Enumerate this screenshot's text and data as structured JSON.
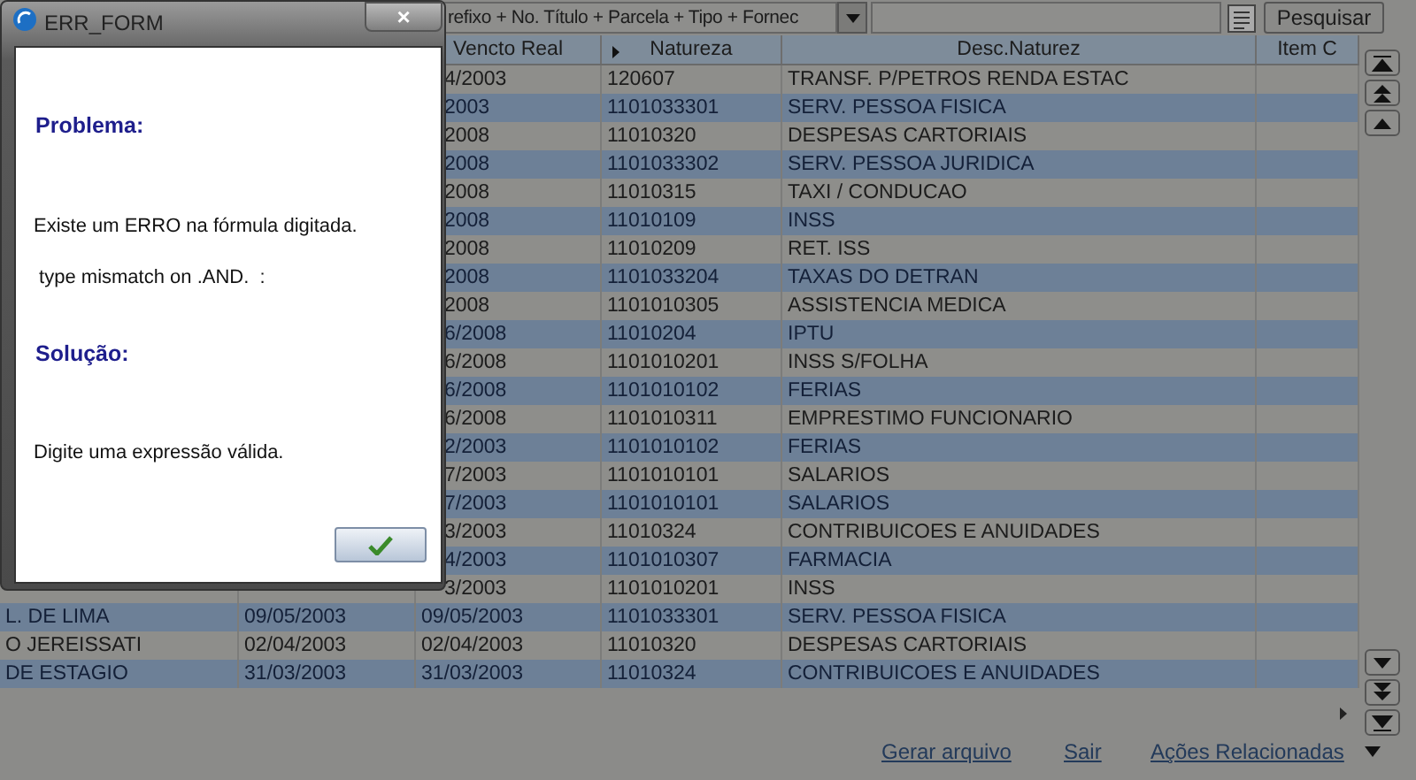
{
  "toolbar": {
    "sort_combo": "refixo + No. Título + Parcela + Tipo + Fornec",
    "search_button": "Pesquisar"
  },
  "table": {
    "columns": [
      "Vencto Real",
      "Natureza",
      "Desc.Naturez",
      "Item C"
    ],
    "rows": [
      {
        "vencto_real": "4/2003",
        "natureza": "120607",
        "desc_naturez": "TRANSF. P/PETROS RENDA ESTAC"
      },
      {
        "vencto_real": "2003",
        "natureza": "1101033301",
        "desc_naturez": "SERV. PESSOA FISICA"
      },
      {
        "vencto_real": "2008",
        "natureza": "11010320",
        "desc_naturez": "DESPESAS CARTORIAIS"
      },
      {
        "vencto_real": "2008",
        "natureza": "1101033302",
        "desc_naturez": "SERV. PESSOA JURIDICA"
      },
      {
        "vencto_real": "2008",
        "natureza": "11010315",
        "desc_naturez": "TAXI / CONDUCAO"
      },
      {
        "vencto_real": "2008",
        "natureza": "11010109",
        "desc_naturez": "INSS"
      },
      {
        "vencto_real": "2008",
        "natureza": "11010209",
        "desc_naturez": "RET. ISS"
      },
      {
        "vencto_real": "2008",
        "natureza": "1101033204",
        "desc_naturez": "TAXAS DO DETRAN"
      },
      {
        "vencto_real": "2008",
        "natureza": "1101010305",
        "desc_naturez": "ASSISTENCIA MEDICA"
      },
      {
        "vencto_real": "6/2008",
        "natureza": "11010204",
        "desc_naturez": "IPTU"
      },
      {
        "vencto_real": "6/2008",
        "natureza": "1101010201",
        "desc_naturez": "INSS S/FOLHA"
      },
      {
        "vencto_real": "6/2008",
        "natureza": "1101010102",
        "desc_naturez": "FERIAS"
      },
      {
        "vencto_real": "6/2008",
        "natureza": "1101010311",
        "desc_naturez": "EMPRESTIMO FUNCIONARIO"
      },
      {
        "vencto_real": "2/2003",
        "natureza": "1101010102",
        "desc_naturez": "FERIAS"
      },
      {
        "vencto_real": "7/2003",
        "natureza": "1101010101",
        "desc_naturez": "SALARIOS"
      },
      {
        "vencto_real": "7/2003",
        "natureza": "1101010101",
        "desc_naturez": "SALARIOS"
      },
      {
        "vencto_real": "3/2003",
        "natureza": "11010324",
        "desc_naturez": "CONTRIBUICOES E ANUIDADES"
      },
      {
        "vencto_real": "4/2003",
        "natureza": "1101010307",
        "desc_naturez": "FARMACIA"
      },
      {
        "vencto_real": "3/2003",
        "natureza": "1101010201",
        "desc_naturez": "INSS"
      },
      {
        "column_1": "L. DE LIMA",
        "column_2": "09/05/2003",
        "vencto_real": "09/05/2003",
        "natureza": "1101033301",
        "desc_naturez": "SERV. PESSOA FISICA"
      },
      {
        "column_1": "O JEREISSATI",
        "column_2": "02/04/2003",
        "vencto_real": "02/04/2003",
        "natureza": "11010320",
        "desc_naturez": "DESPESAS CARTORIAIS"
      },
      {
        "column_1": "DE ESTAGIO",
        "column_2": "31/03/2003",
        "vencto_real": "31/03/2003",
        "natureza": "11010324",
        "desc_naturez": "CONTRIBUICOES E ANUIDADES"
      }
    ]
  },
  "footer_links": [
    "Gerar arquivo",
    "Sair",
    "Ações Relacionadas"
  ],
  "dialog": {
    "title": "ERR_FORM",
    "close": "×",
    "problem_heading": "Problema:",
    "problem_lines": [
      "Existe um ERRO na fórmula digitada.",
      " type mismatch on .AND.  :"
    ],
    "solution_heading": "Solução:",
    "solution_text": "Digite uma expressão válida."
  }
}
